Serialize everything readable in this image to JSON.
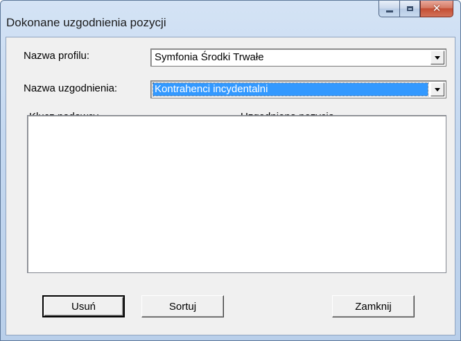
{
  "window": {
    "title": "Dokonane uzgodnienia pozycji",
    "close_glyph": "✕"
  },
  "form": {
    "profile_label": "Nazwa profilu:",
    "profile_value": "Symfonia Środki Trwałe",
    "match_label": "Nazwa uzgodnienia:",
    "match_value": "Kontrahenci incydentalni"
  },
  "list": {
    "columns": [
      "Klucz nadawcy",
      "Uzgodniona pozycja"
    ],
    "rows": []
  },
  "buttons": {
    "delete": "Usuń",
    "sort": "Sortuj",
    "close": "Zamknij"
  },
  "icons": {
    "minimize": "minimize-icon",
    "maximize": "maximize-icon",
    "close": "close-icon",
    "dropdown": "chevron-down-icon"
  },
  "colors": {
    "selection": "#3399ff",
    "close_button": "#c44e33"
  }
}
